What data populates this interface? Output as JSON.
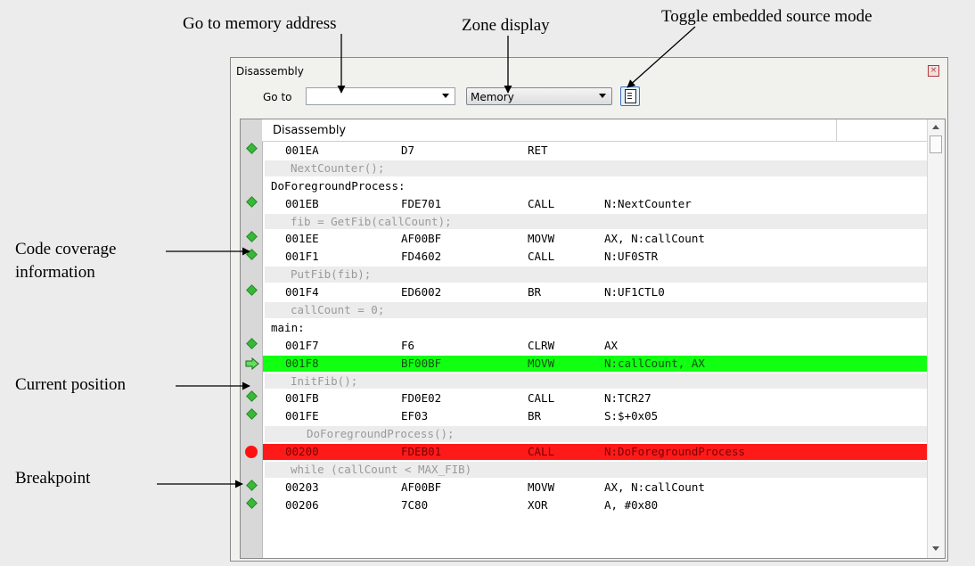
{
  "callouts": {
    "goto": "Go to memory address",
    "zone": "Zone display",
    "toggle": "Toggle embedded source mode",
    "coverage_line1": "Code coverage",
    "coverage_line2": "information",
    "current": "Current position",
    "breakpoint": "Breakpoint"
  },
  "window": {
    "title": "Disassembly",
    "close_icon": "close-icon"
  },
  "toolbar": {
    "goto_label": "Go to",
    "goto_value": "",
    "zone_value": "Memory",
    "source_mode_icon": "document-icon"
  },
  "table": {
    "header": "Disassembly"
  },
  "rows": [
    {
      "kind": "instr",
      "marker": "coverage",
      "addr": "001EA",
      "bytes": "D7",
      "mnemonic": "RET",
      "operand": ""
    },
    {
      "kind": "src",
      "text": "NextCounter();"
    },
    {
      "kind": "label",
      "text": "DoForegroundProcess:"
    },
    {
      "kind": "instr",
      "marker": "coverage",
      "addr": "001EB",
      "bytes": "FDE701",
      "mnemonic": "CALL",
      "operand": "N:NextCounter"
    },
    {
      "kind": "src",
      "text": "fib = GetFib(callCount);"
    },
    {
      "kind": "instr",
      "marker": "coverage",
      "addr": "001EE",
      "bytes": "AF00BF",
      "mnemonic": "MOVW",
      "operand": "AX, N:callCount"
    },
    {
      "kind": "instr",
      "marker": "coverage",
      "addr": "001F1",
      "bytes": "FD4602",
      "mnemonic": "CALL",
      "operand": "N:UF0STR"
    },
    {
      "kind": "src",
      "text": "PutFib(fib);"
    },
    {
      "kind": "instr",
      "marker": "coverage",
      "addr": "001F4",
      "bytes": "ED6002",
      "mnemonic": "BR",
      "operand": "N:UF1CTL0"
    },
    {
      "kind": "src",
      "text": "callCount = 0;"
    },
    {
      "kind": "label",
      "text": "main:"
    },
    {
      "kind": "instr",
      "marker": "coverage",
      "addr": "001F7",
      "bytes": "F6",
      "mnemonic": "CLRW",
      "operand": "AX"
    },
    {
      "kind": "instr",
      "marker": "current",
      "addr": "001F8",
      "bytes": "BF00BF",
      "mnemonic": "MOVW",
      "operand": "N:callCount, AX"
    },
    {
      "kind": "src",
      "text": "InitFib();"
    },
    {
      "kind": "instr",
      "marker": "coverage",
      "addr": "001FB",
      "bytes": "FD0E02",
      "mnemonic": "CALL",
      "operand": "N:TCR27"
    },
    {
      "kind": "instr",
      "marker": "coverage",
      "addr": "001FE",
      "bytes": "EF03",
      "mnemonic": "BR",
      "operand": "S:$+0x05"
    },
    {
      "kind": "src2",
      "text": "DoForegroundProcess();"
    },
    {
      "kind": "instr",
      "marker": "breakpoint",
      "addr": "00200",
      "bytes": "FDEB01",
      "mnemonic": "CALL",
      "operand": "N:DoForegroundProcess"
    },
    {
      "kind": "src",
      "text": "while (callCount < MAX_FIB)"
    },
    {
      "kind": "instr",
      "marker": "coverage",
      "addr": "00203",
      "bytes": "AF00BF",
      "mnemonic": "MOVW",
      "operand": "AX, N:callCount"
    },
    {
      "kind": "instr",
      "marker": "coverage",
      "addr": "00206",
      "bytes": "7C80",
      "mnemonic": "XOR",
      "operand": "A, #0x80"
    }
  ]
}
